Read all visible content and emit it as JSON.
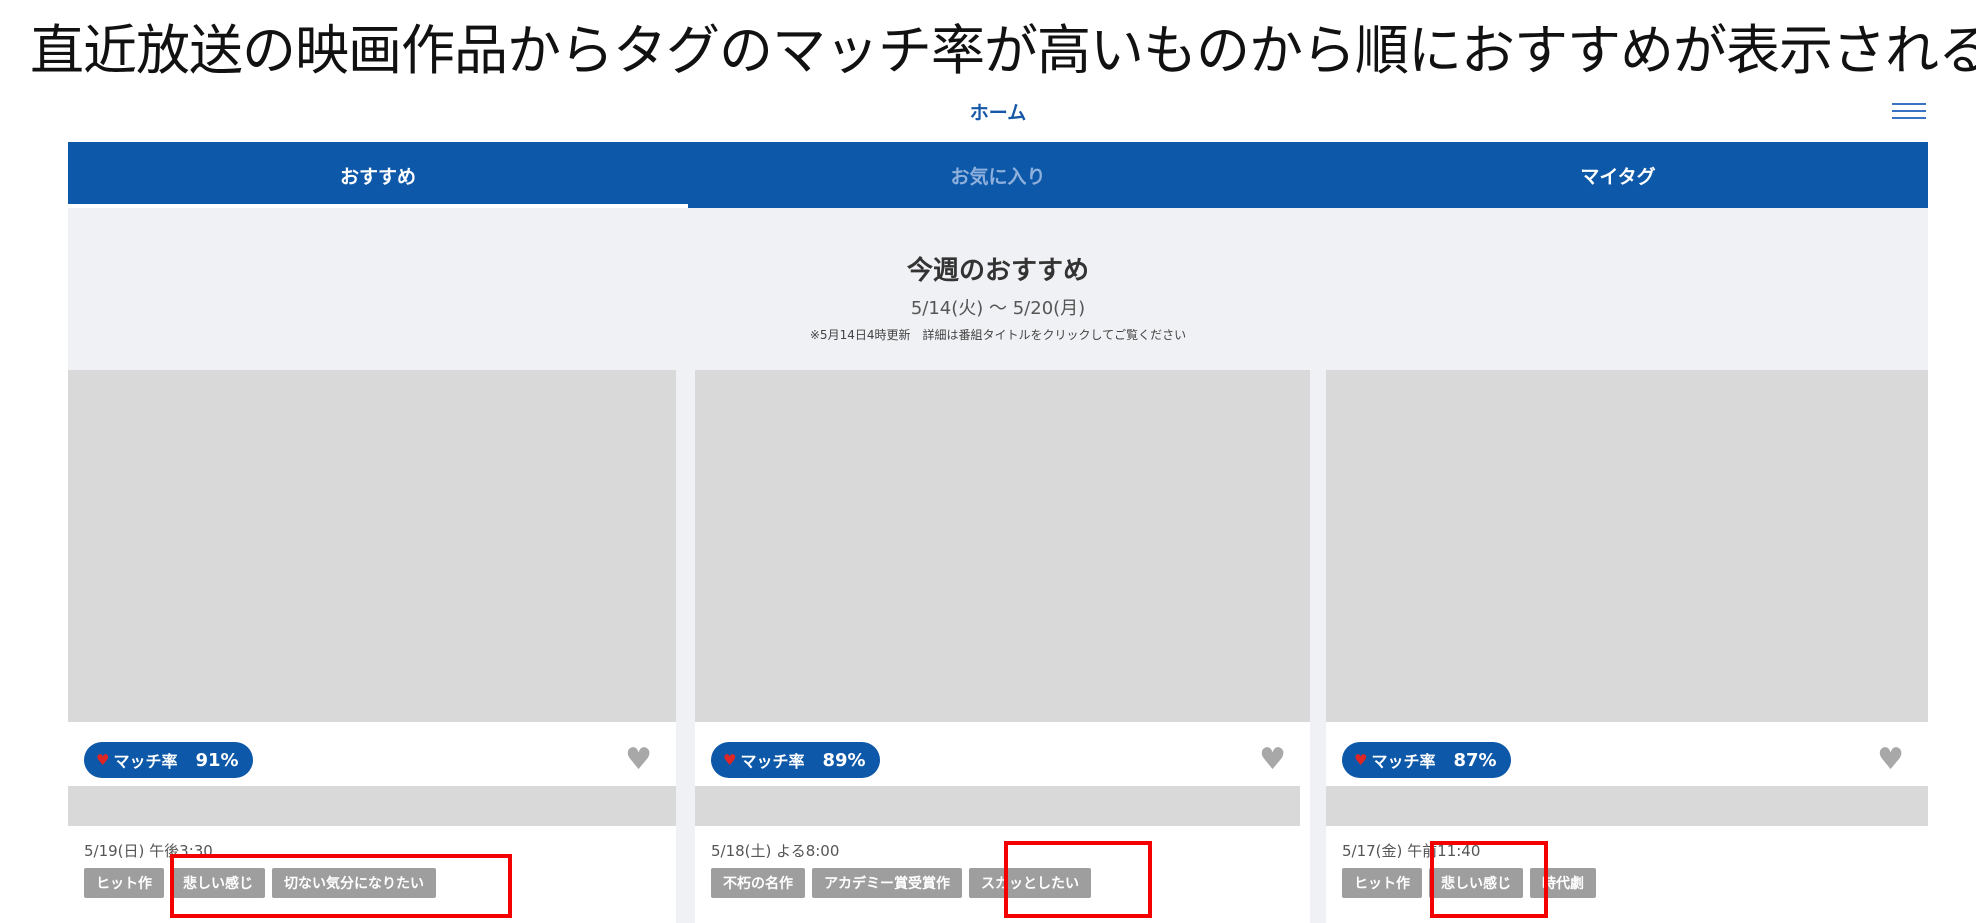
{
  "caption": "直近放送の映画作品からタグのマッチ率が高いものから順におすすめが表示される",
  "header": {
    "title": "ホーム",
    "menu_icon": "hamburger-icon"
  },
  "tabs": [
    {
      "label": "おすすめ",
      "active": true
    },
    {
      "label": "お気に入り",
      "active": false
    },
    {
      "label": "マイタグ",
      "active": false
    }
  ],
  "hero": {
    "title": "今週のおすすめ",
    "range": "5/14(火) ～ 5/20(月)",
    "note": "※5月14日4時更新　詳細は番組タイトルをクリックしてご覧ください"
  },
  "cards": [
    {
      "match_label": "マッチ率",
      "match_value": "91%",
      "air_time": "5/19(日) 午後3:30",
      "tags": [
        "ヒット作",
        "悲しい感じ",
        "切ない気分になりたい"
      ]
    },
    {
      "match_label": "マッチ率",
      "match_value": "89%",
      "air_time": "5/18(土) よる8:00",
      "tags": [
        "不朽の名作",
        "アカデミー賞受賞作",
        "スカッとしたい"
      ]
    },
    {
      "match_label": "マッチ率",
      "match_value": "87%",
      "air_time": "5/17(金) 午前11:40",
      "tags": [
        "ヒット作",
        "悲しい感じ",
        "時代劇"
      ]
    }
  ],
  "colors": {
    "brand_blue": "#0d58a8",
    "highlight_red": "#f40000",
    "tag_gray": "#9e9e9e",
    "heart_red": "#e02525"
  }
}
